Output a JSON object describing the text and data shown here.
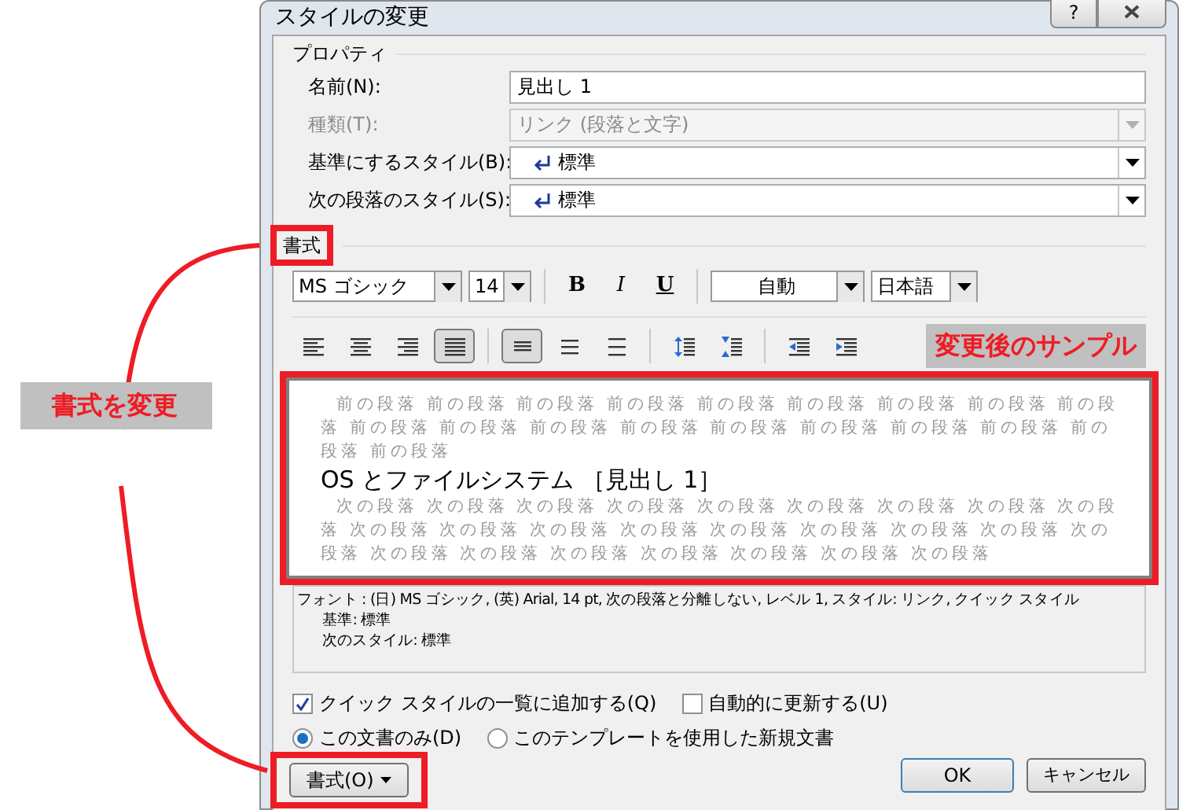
{
  "dialog": {
    "title": "スタイルの変更",
    "help_button": "?"
  },
  "properties": {
    "legend": "プロパティ",
    "fields": [
      {
        "label": "名前(N):",
        "value": "見出し 1",
        "kind": "text",
        "disabled": false
      },
      {
        "label": "種類(T):",
        "value": "リンク (段落と文字)",
        "kind": "combo",
        "disabled": true
      },
      {
        "label": "基準にするスタイル(B):",
        "value": "標準",
        "kind": "style-combo",
        "disabled": false
      },
      {
        "label": "次の段落のスタイル(S):",
        "value": "標準",
        "kind": "style-combo",
        "disabled": false
      }
    ]
  },
  "format": {
    "legend": "書式",
    "font": "MS ゴシック",
    "size": "14",
    "bold": "B",
    "italic": "I",
    "underline": "U",
    "color_setting": "自動",
    "language": "日本語",
    "paragraph_buttons": [
      {
        "kind": "align-left",
        "selected": false
      },
      {
        "kind": "align-center",
        "selected": false
      },
      {
        "kind": "align-right",
        "selected": false
      },
      {
        "kind": "justify",
        "selected": true
      },
      {
        "kind": "sep"
      },
      {
        "kind": "spacing-single",
        "selected": true
      },
      {
        "kind": "spacing-half",
        "selected": false
      },
      {
        "kind": "spacing-double",
        "selected": false
      },
      {
        "kind": "sep"
      },
      {
        "kind": "space-increase",
        "selected": false
      },
      {
        "kind": "space-decrease",
        "selected": false
      },
      {
        "kind": "sep"
      },
      {
        "kind": "indent-decrease",
        "selected": false
      },
      {
        "kind": "indent-increase",
        "selected": false
      }
    ]
  },
  "preview": {
    "previous_text": "前の段落 前の段落 前の段落 前の段落 前の段落 前の段落 前の段落 前の段落 前の段落 前の段落 前の段落 前の段落 前の段落 前の段落 前の段落 前の段落 前の段落 前の段落 前の段落",
    "heading": "OS とファイルシステム ［見出し 1］",
    "next_text": "次の段落 次の段落 次の段落 次の段落 次の段落 次の段落 次の段落 次の段落 次の段落 次の段落 次の段落 次の段落 次の段落 次の段落 次の段落 次の段落 次の段落 次の段落 次の段落 次の段落 次の段落 次の段落 次の段落 次の段落 次の段落"
  },
  "description": [
    "フォント : (日) MS ゴシック, (英) Arial, 14 pt, 次の段落と分離しない, レベル 1, スタイル: リンク, クイック スタイル",
    "基準: 標準",
    "次のスタイル: 標準"
  ],
  "checkboxes": [
    {
      "label": "クイック スタイルの一覧に追加する(Q)",
      "checked": true
    },
    {
      "label": "自動的に更新する(U)",
      "checked": false
    }
  ],
  "radios": [
    {
      "label": "この文書のみ(D)",
      "selected": true
    },
    {
      "label": "このテンプレートを使用した新規文書",
      "selected": false
    }
  ],
  "buttons": {
    "format": "書式(O)",
    "ok": "OK",
    "cancel": "キャンセル"
  },
  "annotations": {
    "sample_label": "変更後のサンプル",
    "format_label": "書式を変更"
  }
}
